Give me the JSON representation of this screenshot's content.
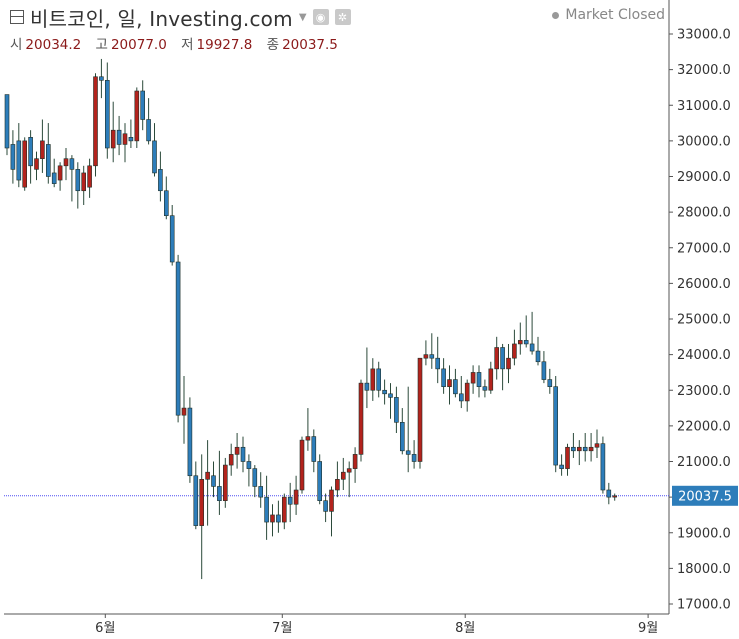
{
  "header": {
    "title": "비트코인, 일, Investing.com",
    "status": "Market Closed",
    "ohlc": [
      {
        "key": "시",
        "value": "20034.2"
      },
      {
        "key": "고",
        "value": "20077.0"
      },
      {
        "key": "저",
        "value": "19927.8"
      },
      {
        "key": "종",
        "value": "20037.5"
      }
    ]
  },
  "icons": {
    "menu": "layout-icon",
    "dropdown": "chevron-down-icon",
    "camera": "camera-icon",
    "settings": "gear-icon"
  },
  "colors": {
    "up": "#b3231d",
    "down": "#2d7dba",
    "wick": "#2b4a3a",
    "price_line": "#4e4ef2",
    "price_label_bg": "#2d7dba",
    "axis": "#555555"
  },
  "chart_data": {
    "type": "candlestick",
    "ylim": [
      16600,
      34000
    ],
    "y_ticks": [
      "17000.0",
      "18000.0",
      "19000.0",
      "20000.0",
      "21000.0",
      "22000.0",
      "23000.0",
      "24000.0",
      "25000.0",
      "26000.0",
      "27000.0",
      "28000.0",
      "29000.0",
      "30000.0",
      "31000.0",
      "32000.0",
      "33000.0"
    ],
    "x_labels": [
      {
        "label": "6월",
        "index": 17
      },
      {
        "label": "7월",
        "index": 47
      },
      {
        "label": "8월",
        "index": 78
      },
      {
        "label": "9월",
        "index": 109
      }
    ],
    "last_price": 20037.5,
    "last_price_label": "20037.5",
    "candles": [
      [
        31300,
        31300,
        29600,
        29800
      ],
      [
        29900,
        30300,
        28800,
        29200
      ],
      [
        30000,
        30500,
        28700,
        28900
      ],
      [
        28700,
        30100,
        28600,
        30000
      ],
      [
        30100,
        30300,
        28800,
        29300
      ],
      [
        29200,
        29700,
        28900,
        29500
      ],
      [
        29500,
        30600,
        29100,
        30000
      ],
      [
        29900,
        30500,
        28800,
        29000
      ],
      [
        29100,
        29500,
        28700,
        28800
      ],
      [
        28900,
        29400,
        28600,
        29300
      ],
      [
        29300,
        29800,
        28900,
        29500
      ],
      [
        29500,
        29600,
        28300,
        29200
      ],
      [
        29200,
        29400,
        28100,
        28600
      ],
      [
        28600,
        29300,
        28200,
        29100
      ],
      [
        28700,
        29500,
        28400,
        29300
      ],
      [
        29300,
        31900,
        29000,
        31800
      ],
      [
        31800,
        32300,
        31200,
        31700
      ],
      [
        31700,
        32200,
        29500,
        29800
      ],
      [
        29800,
        31100,
        29400,
        30300
      ],
      [
        30300,
        30700,
        29600,
        29900
      ],
      [
        29900,
        30500,
        29400,
        30200
      ],
      [
        30100,
        30600,
        29800,
        30000
      ],
      [
        30000,
        31500,
        29800,
        31400
      ],
      [
        31400,
        31700,
        30300,
        30600
      ],
      [
        30600,
        31200,
        29900,
        30000
      ],
      [
        30000,
        30500,
        29000,
        29100
      ],
      [
        29200,
        29700,
        28300,
        28600
      ],
      [
        28600,
        29000,
        27800,
        27900
      ],
      [
        27900,
        28200,
        26500,
        26600
      ],
      [
        26600,
        26800,
        22100,
        22300
      ],
      [
        22300,
        23400,
        21500,
        22500
      ],
      [
        22500,
        22800,
        20400,
        20600
      ],
      [
        20600,
        21000,
        19100,
        19200
      ],
      [
        19200,
        21200,
        17700,
        20500
      ],
      [
        20500,
        21600,
        19200,
        20700
      ],
      [
        20600,
        21000,
        20000,
        20300
      ],
      [
        20300,
        21300,
        19500,
        19900
      ],
      [
        19900,
        21100,
        19700,
        20900
      ],
      [
        20900,
        21500,
        20600,
        21200
      ],
      [
        21200,
        21800,
        20800,
        21400
      ],
      [
        21400,
        21700,
        20700,
        21000
      ],
      [
        21000,
        21200,
        20300,
        20800
      ],
      [
        20800,
        20900,
        20000,
        20300
      ],
      [
        20300,
        20700,
        19700,
        20000
      ],
      [
        20000,
        20600,
        18800,
        19300
      ],
      [
        19300,
        19800,
        18900,
        19500
      ],
      [
        19500,
        19900,
        19000,
        19300
      ],
      [
        19300,
        20100,
        19100,
        20000
      ],
      [
        20000,
        20400,
        19300,
        19800
      ],
      [
        19800,
        20600,
        19500,
        20200
      ],
      [
        20200,
        21700,
        20100,
        21600
      ],
      [
        21600,
        22500,
        21300,
        21700
      ],
      [
        21700,
        21900,
        20700,
        21000
      ],
      [
        21000,
        21200,
        19800,
        19900
      ],
      [
        19900,
        20100,
        19300,
        19600
      ],
      [
        19600,
        20300,
        18900,
        20200
      ],
      [
        20200,
        21000,
        20000,
        20500
      ],
      [
        20500,
        21100,
        20200,
        20700
      ],
      [
        20700,
        21000,
        20000,
        20800
      ],
      [
        20800,
        21400,
        20400,
        21200
      ],
      [
        21200,
        23300,
        21000,
        23200
      ],
      [
        23200,
        24200,
        22500,
        23000
      ],
      [
        23000,
        23900,
        22700,
        23600
      ],
      [
        23600,
        23800,
        22800,
        23000
      ],
      [
        23000,
        23300,
        22600,
        22900
      ],
      [
        22900,
        23200,
        22200,
        22800
      ],
      [
        22800,
        23100,
        21800,
        22100
      ],
      [
        22100,
        22500,
        21200,
        21300
      ],
      [
        21300,
        23100,
        20700,
        21200
      ],
      [
        21200,
        21600,
        20800,
        21000
      ],
      [
        21000,
        23900,
        20800,
        23900
      ],
      [
        23900,
        24400,
        23700,
        24000
      ],
      [
        24000,
        24600,
        23600,
        23900
      ],
      [
        23900,
        24500,
        23200,
        23600
      ],
      [
        23600,
        23900,
        22900,
        23100
      ],
      [
        23100,
        23700,
        22600,
        23300
      ],
      [
        23300,
        23600,
        22800,
        22900
      ],
      [
        22900,
        23400,
        22500,
        22700
      ],
      [
        22700,
        23300,
        22400,
        23200
      ],
      [
        23200,
        23700,
        22900,
        23500
      ],
      [
        23500,
        23700,
        22800,
        23100
      ],
      [
        23100,
        23300,
        22800,
        23000
      ],
      [
        23000,
        23800,
        22900,
        23600
      ],
      [
        23600,
        24500,
        23300,
        24200
      ],
      [
        24200,
        24300,
        23000,
        23600
      ],
      [
        23600,
        24300,
        23200,
        23900
      ],
      [
        23900,
        24700,
        23700,
        24300
      ],
      [
        24300,
        24900,
        24000,
        24400
      ],
      [
        24400,
        25100,
        24200,
        24300
      ],
      [
        24300,
        25200,
        24000,
        24100
      ],
      [
        24100,
        24500,
        23700,
        23800
      ],
      [
        23800,
        24100,
        23200,
        23300
      ],
      [
        23300,
        23600,
        22900,
        23100
      ],
      [
        23100,
        23400,
        20700,
        20900
      ],
      [
        20900,
        21200,
        20600,
        20800
      ],
      [
        20800,
        21500,
        20600,
        21400
      ],
      [
        21400,
        21800,
        21100,
        21300
      ],
      [
        21300,
        21600,
        20900,
        21400
      ],
      [
        21400,
        21800,
        21000,
        21300
      ],
      [
        21300,
        21800,
        21000,
        21400
      ],
      [
        21400,
        21900,
        21100,
        21500
      ],
      [
        21500,
        21700,
        20100,
        20200
      ],
      [
        20200,
        20400,
        19800,
        20000
      ],
      [
        20000,
        20100,
        19900,
        20037.5
      ]
    ]
  }
}
